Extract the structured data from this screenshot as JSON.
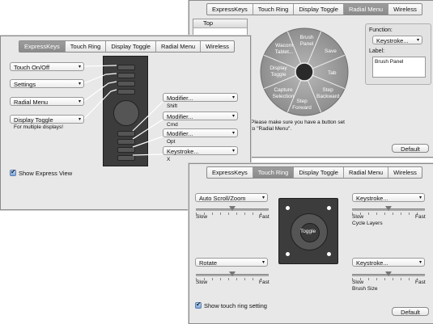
{
  "top_panel": {
    "tabs": [
      "ExpressKeys",
      "Touch Ring",
      "Display Toggle",
      "Radial Menu",
      "Wireless"
    ],
    "active_tab": "Radial Menu",
    "tree_header": "Top",
    "segments": [
      "Brush Panel",
      "Save",
      "Tab",
      "Step Backward",
      "Step Forward",
      "Capture Selection",
      "Display Toggle",
      "Wacom Tablet..."
    ],
    "function_label": "Function:",
    "function_value": "Keystroke...",
    "label_label": "Label:",
    "label_value": "Brush Panel",
    "note": "Please make sure you have a button set to \"Radial Menu\".",
    "default_button": "Default"
  },
  "left_panel": {
    "tabs": [
      "ExpressKeys",
      "Touch Ring",
      "Display Toggle",
      "Radial Menu",
      "Wireless"
    ],
    "active_tab": "ExpressKeys",
    "left_dropdowns": [
      "Touch On/Off",
      "Settings",
      "Radial Menu",
      "Display Toggle"
    ],
    "multi_display_note": "For multiple displays!",
    "right_dropdowns": [
      "Modifier...",
      "Modifier...",
      "Modifier...",
      "Keystroke..."
    ],
    "right_sublabels": [
      "Shift",
      "Cmd",
      "Opt",
      "X"
    ],
    "show_express_view": "Show Express View"
  },
  "bottom_panel": {
    "tabs": [
      "ExpressKeys",
      "Touch Ring",
      "Display Toggle",
      "Radial Menu",
      "Wireless"
    ],
    "active_tab": "Touch Ring",
    "top_left_dropdown": "Auto Scroll/Zoom",
    "top_right_dropdown": "Keystroke...",
    "bottom_left_dropdown": "Rotate",
    "bottom_right_dropdown": "Keystroke...",
    "slow": "Slow",
    "fast": "Fast",
    "top_right_caption": "Cycle Layers",
    "bottom_right_caption": "Brush Size",
    "ring_label": "Toggle",
    "show_touch_ring": "Show touch ring setting",
    "default_button": "Default"
  }
}
